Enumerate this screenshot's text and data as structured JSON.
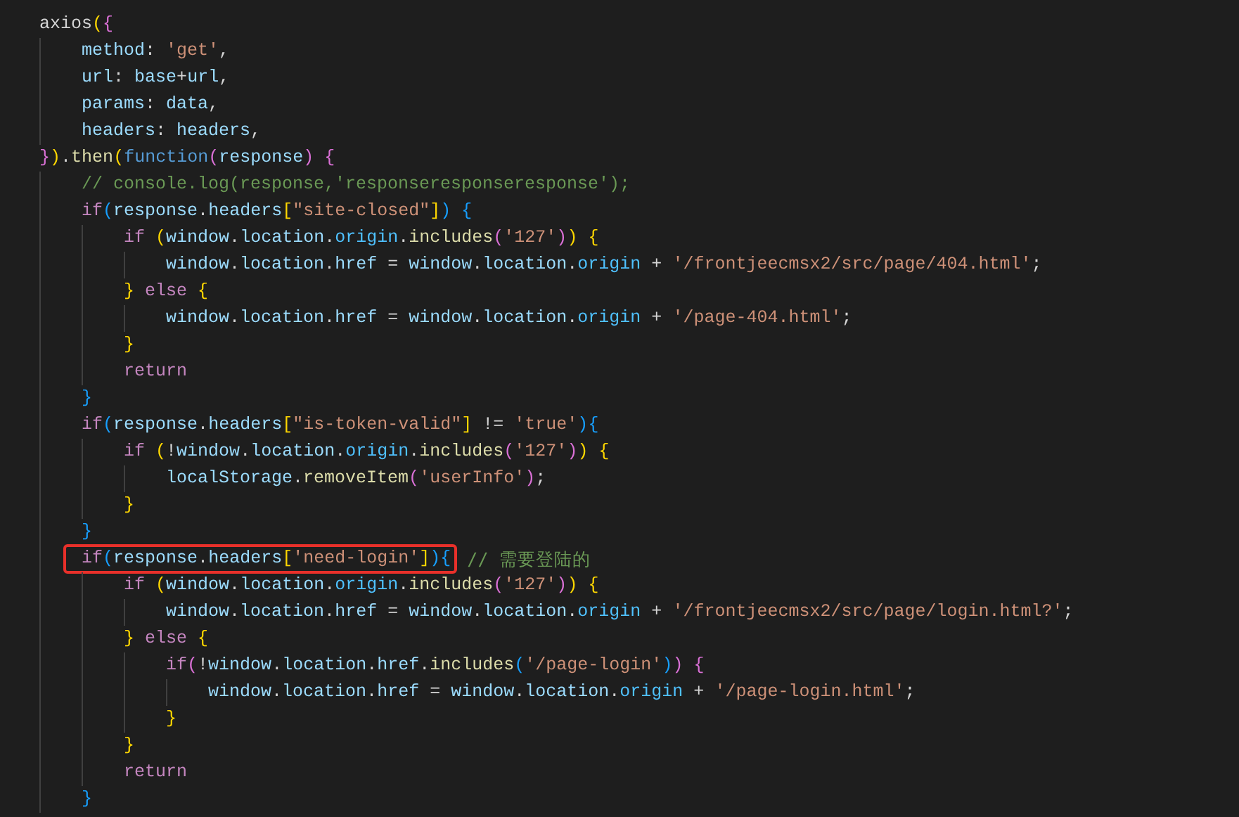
{
  "editor": {
    "lines": [
      {
        "tokens": [
          {
            "text": "axios",
            "kind": "plain"
          },
          {
            "text": "(",
            "kind": "brace1"
          },
          {
            "text": "{",
            "kind": "brace2"
          }
        ]
      },
      {
        "tokens": [
          {
            "text": "    method",
            "kind": "var"
          },
          {
            "text": ": ",
            "kind": "plain"
          },
          {
            "text": "'get'",
            "kind": "str"
          },
          {
            "text": ",",
            "kind": "plain"
          }
        ]
      },
      {
        "tokens": [
          {
            "text": "    url",
            "kind": "var"
          },
          {
            "text": ": ",
            "kind": "plain"
          },
          {
            "text": "base",
            "kind": "var"
          },
          {
            "text": "+",
            "kind": "plain"
          },
          {
            "text": "url",
            "kind": "var"
          },
          {
            "text": ",",
            "kind": "plain"
          }
        ]
      },
      {
        "tokens": [
          {
            "text": "    params",
            "kind": "var"
          },
          {
            "text": ": ",
            "kind": "plain"
          },
          {
            "text": "data",
            "kind": "var"
          },
          {
            "text": ",",
            "kind": "plain"
          }
        ]
      },
      {
        "tokens": [
          {
            "text": "    headers",
            "kind": "var"
          },
          {
            "text": ": ",
            "kind": "plain"
          },
          {
            "text": "headers",
            "kind": "var"
          },
          {
            "text": ",",
            "kind": "plain"
          }
        ]
      },
      {
        "tokens": [
          {
            "text": "}",
            "kind": "brace2"
          },
          {
            "text": ")",
            "kind": "brace1"
          },
          {
            "text": ".",
            "kind": "plain"
          },
          {
            "text": "then",
            "kind": "fn"
          },
          {
            "text": "(",
            "kind": "brace1"
          },
          {
            "text": "function",
            "kind": "kw"
          },
          {
            "text": "(",
            "kind": "brace2"
          },
          {
            "text": "response",
            "kind": "var"
          },
          {
            "text": ")",
            "kind": "brace2"
          },
          {
            "text": " {",
            "kind": "brace2"
          }
        ]
      },
      {
        "tokens": [
          {
            "text": "    // console.log(response,'responseresponseresponse');",
            "kind": "comment"
          }
        ]
      },
      {
        "tokens": [
          {
            "text": "    if",
            "kind": "ctl"
          },
          {
            "text": "(",
            "kind": "brace3"
          },
          {
            "text": "response",
            "kind": "var"
          },
          {
            "text": ".",
            "kind": "plain"
          },
          {
            "text": "headers",
            "kind": "var"
          },
          {
            "text": "[",
            "kind": "brace1"
          },
          {
            "text": "\"site-closed\"",
            "kind": "str"
          },
          {
            "text": "]",
            "kind": "brace1"
          },
          {
            "text": ")",
            "kind": "brace3"
          },
          {
            "text": " {",
            "kind": "brace3"
          }
        ]
      },
      {
        "tokens": [
          {
            "text": "        if",
            "kind": "ctl"
          },
          {
            "text": " (",
            "kind": "brace1"
          },
          {
            "text": "window",
            "kind": "var"
          },
          {
            "text": ".",
            "kind": "plain"
          },
          {
            "text": "location",
            "kind": "var"
          },
          {
            "text": ".",
            "kind": "plain"
          },
          {
            "text": "origin",
            "kind": "const"
          },
          {
            "text": ".",
            "kind": "plain"
          },
          {
            "text": "includes",
            "kind": "fn"
          },
          {
            "text": "(",
            "kind": "brace2"
          },
          {
            "text": "'127'",
            "kind": "str"
          },
          {
            "text": ")",
            "kind": "brace2"
          },
          {
            "text": ")",
            "kind": "brace1"
          },
          {
            "text": " {",
            "kind": "brace1"
          }
        ]
      },
      {
        "tokens": [
          {
            "text": "            window",
            "kind": "var"
          },
          {
            "text": ".",
            "kind": "plain"
          },
          {
            "text": "location",
            "kind": "var"
          },
          {
            "text": ".",
            "kind": "plain"
          },
          {
            "text": "href",
            "kind": "var"
          },
          {
            "text": " = ",
            "kind": "plain"
          },
          {
            "text": "window",
            "kind": "var"
          },
          {
            "text": ".",
            "kind": "plain"
          },
          {
            "text": "location",
            "kind": "var"
          },
          {
            "text": ".",
            "kind": "plain"
          },
          {
            "text": "origin",
            "kind": "const"
          },
          {
            "text": " + ",
            "kind": "plain"
          },
          {
            "text": "'/frontjeecmsx2/src/page/404.html'",
            "kind": "str"
          },
          {
            "text": ";",
            "kind": "plain"
          }
        ]
      },
      {
        "tokens": [
          {
            "text": "        }",
            "kind": "brace1"
          },
          {
            "text": " else ",
            "kind": "ctl"
          },
          {
            "text": "{",
            "kind": "brace1"
          }
        ]
      },
      {
        "tokens": [
          {
            "text": "            window",
            "kind": "var"
          },
          {
            "text": ".",
            "kind": "plain"
          },
          {
            "text": "location",
            "kind": "var"
          },
          {
            "text": ".",
            "kind": "plain"
          },
          {
            "text": "href",
            "kind": "var"
          },
          {
            "text": " = ",
            "kind": "plain"
          },
          {
            "text": "window",
            "kind": "var"
          },
          {
            "text": ".",
            "kind": "plain"
          },
          {
            "text": "location",
            "kind": "var"
          },
          {
            "text": ".",
            "kind": "plain"
          },
          {
            "text": "origin",
            "kind": "const"
          },
          {
            "text": " + ",
            "kind": "plain"
          },
          {
            "text": "'/page-404.html'",
            "kind": "str"
          },
          {
            "text": ";",
            "kind": "plain"
          }
        ]
      },
      {
        "tokens": [
          {
            "text": "        }",
            "kind": "brace1"
          }
        ]
      },
      {
        "tokens": [
          {
            "text": "        return",
            "kind": "ctl"
          }
        ]
      },
      {
        "tokens": [
          {
            "text": "    }",
            "kind": "brace3"
          }
        ]
      },
      {
        "tokens": [
          {
            "text": "    if",
            "kind": "ctl"
          },
          {
            "text": "(",
            "kind": "brace3"
          },
          {
            "text": "response",
            "kind": "var"
          },
          {
            "text": ".",
            "kind": "plain"
          },
          {
            "text": "headers",
            "kind": "var"
          },
          {
            "text": "[",
            "kind": "brace1"
          },
          {
            "text": "\"is-token-valid\"",
            "kind": "str"
          },
          {
            "text": "]",
            "kind": "brace1"
          },
          {
            "text": " != ",
            "kind": "plain"
          },
          {
            "text": "'true'",
            "kind": "str"
          },
          {
            "text": ")",
            "kind": "brace3"
          },
          {
            "text": "{",
            "kind": "brace3"
          }
        ]
      },
      {
        "tokens": [
          {
            "text": "        if",
            "kind": "ctl"
          },
          {
            "text": " (",
            "kind": "brace1"
          },
          {
            "text": "!",
            "kind": "plain"
          },
          {
            "text": "window",
            "kind": "var"
          },
          {
            "text": ".",
            "kind": "plain"
          },
          {
            "text": "location",
            "kind": "var"
          },
          {
            "text": ".",
            "kind": "plain"
          },
          {
            "text": "origin",
            "kind": "const"
          },
          {
            "text": ".",
            "kind": "plain"
          },
          {
            "text": "includes",
            "kind": "fn"
          },
          {
            "text": "(",
            "kind": "brace2"
          },
          {
            "text": "'127'",
            "kind": "str"
          },
          {
            "text": ")",
            "kind": "brace2"
          },
          {
            "text": ")",
            "kind": "brace1"
          },
          {
            "text": " {",
            "kind": "brace1"
          }
        ]
      },
      {
        "tokens": [
          {
            "text": "            localStorage",
            "kind": "var"
          },
          {
            "text": ".",
            "kind": "plain"
          },
          {
            "text": "removeItem",
            "kind": "fn"
          },
          {
            "text": "(",
            "kind": "brace2"
          },
          {
            "text": "'userInfo'",
            "kind": "str"
          },
          {
            "text": ")",
            "kind": "brace2"
          },
          {
            "text": ";",
            "kind": "plain"
          }
        ]
      },
      {
        "tokens": [
          {
            "text": "        }",
            "kind": "brace1"
          }
        ]
      },
      {
        "tokens": [
          {
            "text": "    }",
            "kind": "brace3"
          }
        ]
      },
      {
        "boxed": [
          {
            "text": "    if",
            "kind": "ctl"
          },
          {
            "text": "(",
            "kind": "brace3"
          },
          {
            "text": "response",
            "kind": "var"
          },
          {
            "text": ".",
            "kind": "plain"
          },
          {
            "text": "headers",
            "kind": "var"
          },
          {
            "text": "[",
            "kind": "brace1"
          },
          {
            "text": "'need-login'",
            "kind": "str"
          },
          {
            "text": "]",
            "kind": "brace1"
          },
          {
            "text": ")",
            "kind": "brace3"
          },
          {
            "text": "{",
            "kind": "brace3"
          }
        ],
        "tokens": [
          {
            "text": " // 需要登陆的",
            "kind": "comment"
          }
        ]
      },
      {
        "tokens": [
          {
            "text": "        if",
            "kind": "ctl"
          },
          {
            "text": " (",
            "kind": "brace1"
          },
          {
            "text": "window",
            "kind": "var"
          },
          {
            "text": ".",
            "kind": "plain"
          },
          {
            "text": "location",
            "kind": "var"
          },
          {
            "text": ".",
            "kind": "plain"
          },
          {
            "text": "origin",
            "kind": "const"
          },
          {
            "text": ".",
            "kind": "plain"
          },
          {
            "text": "includes",
            "kind": "fn"
          },
          {
            "text": "(",
            "kind": "brace2"
          },
          {
            "text": "'127'",
            "kind": "str"
          },
          {
            "text": ")",
            "kind": "brace2"
          },
          {
            "text": ")",
            "kind": "brace1"
          },
          {
            "text": " {",
            "kind": "brace1"
          }
        ]
      },
      {
        "tokens": [
          {
            "text": "            window",
            "kind": "var"
          },
          {
            "text": ".",
            "kind": "plain"
          },
          {
            "text": "location",
            "kind": "var"
          },
          {
            "text": ".",
            "kind": "plain"
          },
          {
            "text": "href",
            "kind": "var"
          },
          {
            "text": " = ",
            "kind": "plain"
          },
          {
            "text": "window",
            "kind": "var"
          },
          {
            "text": ".",
            "kind": "plain"
          },
          {
            "text": "location",
            "kind": "var"
          },
          {
            "text": ".",
            "kind": "plain"
          },
          {
            "text": "origin",
            "kind": "const"
          },
          {
            "text": " + ",
            "kind": "plain"
          },
          {
            "text": "'/frontjeecmsx2/src/page/login.html?'",
            "kind": "str"
          },
          {
            "text": ";",
            "kind": "plain"
          }
        ]
      },
      {
        "tokens": [
          {
            "text": "        }",
            "kind": "brace1"
          },
          {
            "text": " else ",
            "kind": "ctl"
          },
          {
            "text": "{",
            "kind": "brace1"
          }
        ]
      },
      {
        "tokens": [
          {
            "text": "            if",
            "kind": "ctl"
          },
          {
            "text": "(",
            "kind": "brace2"
          },
          {
            "text": "!",
            "kind": "plain"
          },
          {
            "text": "window",
            "kind": "var"
          },
          {
            "text": ".",
            "kind": "plain"
          },
          {
            "text": "location",
            "kind": "var"
          },
          {
            "text": ".",
            "kind": "plain"
          },
          {
            "text": "href",
            "kind": "var"
          },
          {
            "text": ".",
            "kind": "plain"
          },
          {
            "text": "includes",
            "kind": "fn"
          },
          {
            "text": "(",
            "kind": "brace3"
          },
          {
            "text": "'/page-login'",
            "kind": "str"
          },
          {
            "text": ")",
            "kind": "brace3"
          },
          {
            "text": ")",
            "kind": "brace2"
          },
          {
            "text": " {",
            "kind": "brace2"
          }
        ]
      },
      {
        "tokens": [
          {
            "text": "                window",
            "kind": "var"
          },
          {
            "text": ".",
            "kind": "plain"
          },
          {
            "text": "location",
            "kind": "var"
          },
          {
            "text": ".",
            "kind": "plain"
          },
          {
            "text": "href",
            "kind": "var"
          },
          {
            "text": " = ",
            "kind": "plain"
          },
          {
            "text": "window",
            "kind": "var"
          },
          {
            "text": ".",
            "kind": "plain"
          },
          {
            "text": "location",
            "kind": "var"
          },
          {
            "text": ".",
            "kind": "plain"
          },
          {
            "text": "origin",
            "kind": "const"
          },
          {
            "text": " + ",
            "kind": "plain"
          },
          {
            "text": "'/page-login.html'",
            "kind": "str"
          },
          {
            "text": ";",
            "kind": "plain"
          }
        ]
      },
      {
        "tokens": [
          {
            "text": "            }",
            "kind": "brace1"
          }
        ]
      },
      {
        "tokens": [
          {
            "text": "        }",
            "kind": "brace1"
          }
        ]
      },
      {
        "tokens": [
          {
            "text": "        return",
            "kind": "ctl"
          }
        ]
      },
      {
        "tokens": [
          {
            "text": "    }",
            "kind": "brace3"
          }
        ]
      }
    ]
  }
}
